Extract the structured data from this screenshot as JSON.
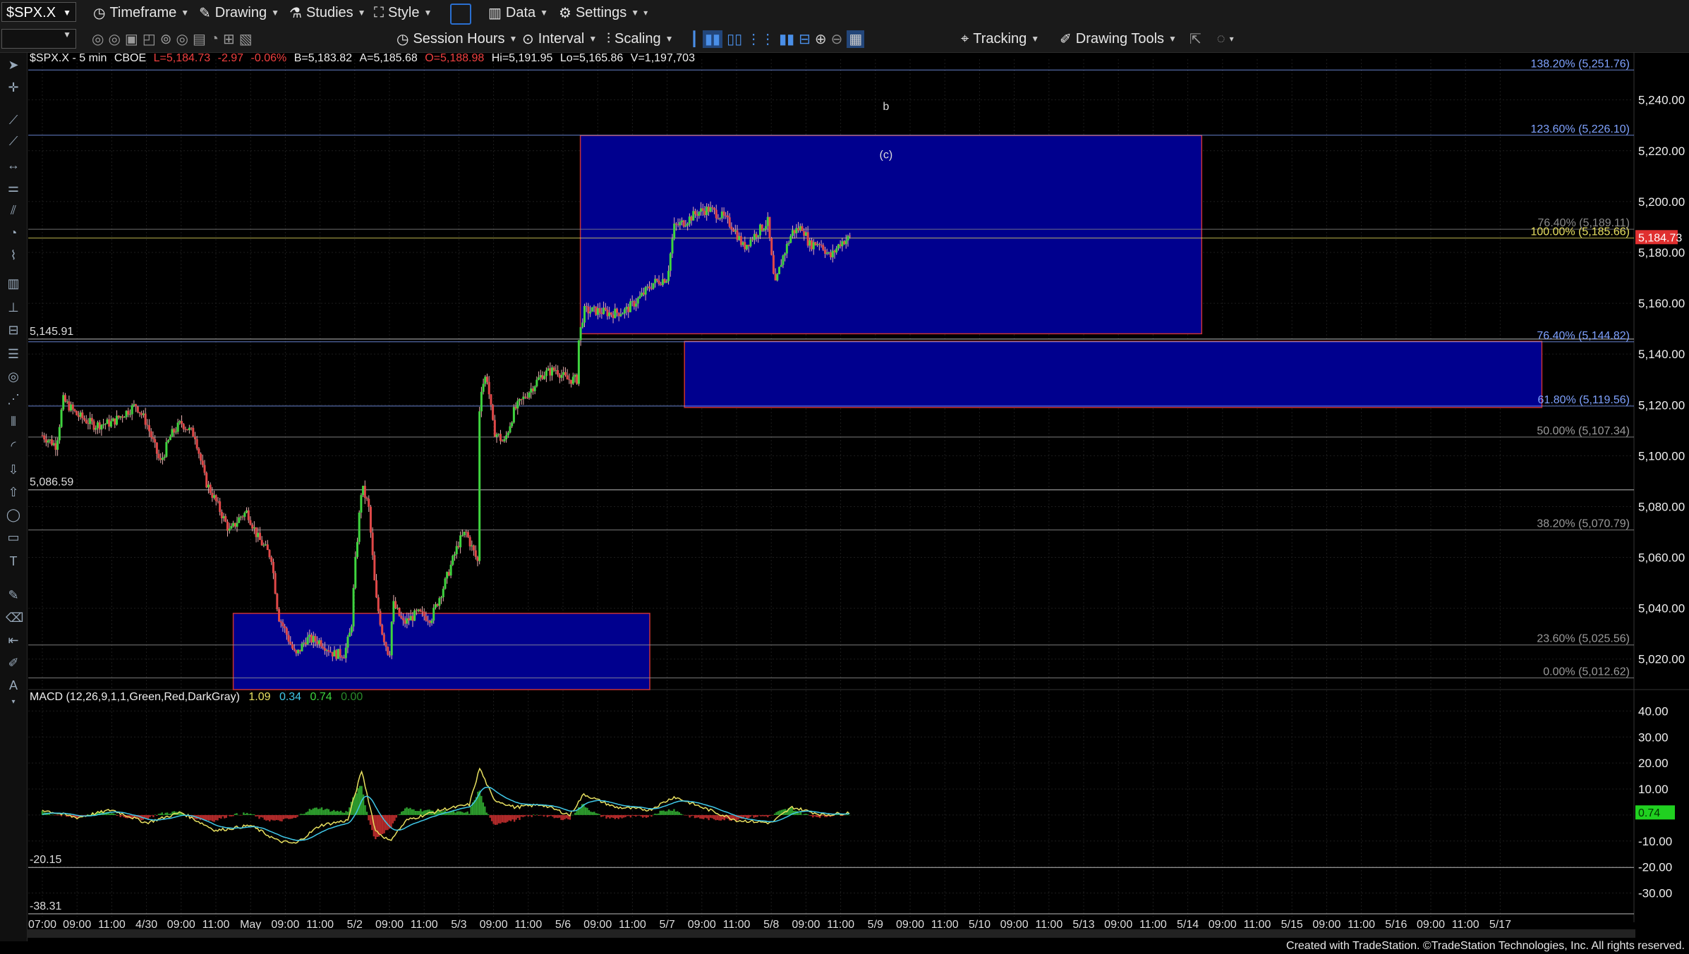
{
  "toolbar": {
    "symbol": "$SPX.X",
    "timeframe": "Timeframe",
    "drawing": "Drawing",
    "studies": "Studies",
    "style": "Style",
    "data": "Data",
    "settings": "Settings",
    "session_hours": "Session Hours",
    "interval": "Interval",
    "scaling": "Scaling",
    "tracking": "Tracking",
    "drawing_tools": "Drawing Tools"
  },
  "info_bar": {
    "symbol": "$SPX.X - 5 min",
    "exchange": "CBOE",
    "last": "L=5,184.73",
    "change": "-2.97",
    "change_pct": "-0.06%",
    "bid": "B=5,183.82",
    "ask": "A=5,185.68",
    "open": "O=5,188.98",
    "high": "Hi=5,191.95",
    "low": "Lo=5,165.86",
    "volume": "V=1,197,703"
  },
  "colors": {
    "up": "#3fd43f",
    "down": "#e04848",
    "box_fill": "#00008e",
    "box_border": "#c83232",
    "fib": "#9a9a9a",
    "price_tag": "#e03030",
    "macd_tag": "#20d020"
  },
  "chart_data": [
    {
      "type": "line",
      "subtype": "candlestick",
      "ylim": [
        5008,
        5256
      ],
      "y_ticks": [
        "5,020.00",
        "5,040.00",
        "5,060.00",
        "5,080.00",
        "5,100.00",
        "5,120.00",
        "5,140.00",
        "5,160.00",
        "5,180.00",
        "5,200.00",
        "5,220.00",
        "5,240.00"
      ],
      "y_tick_values": [
        5020,
        5040,
        5060,
        5080,
        5100,
        5120,
        5140,
        5160,
        5180,
        5200,
        5220,
        5240
      ],
      "x_ticks": [
        "07:00",
        "09:00",
        "11:00",
        "4/30",
        "09:00",
        "11:00",
        "May",
        "09:00",
        "11:00",
        "5/2",
        "09:00",
        "11:00",
        "5/3",
        "09:00",
        "11:00",
        "5/6",
        "09:00",
        "11:00",
        "5/7",
        "09:00",
        "11:00",
        "5/8",
        "09:00",
        "11:00",
        "5/9",
        "09:00",
        "11:00",
        "5/10",
        "09:00",
        "11:00",
        "5/13",
        "09:00",
        "11:00",
        "5/14",
        "09:00",
        "11:00",
        "5/15",
        "09:00",
        "11:00",
        "5/16",
        "09:00",
        "11:00",
        "5/17"
      ],
      "price_path": [
        {
          "t": 0,
          "v": 5108
        },
        {
          "t": 0.4,
          "v": 5104
        },
        {
          "t": 0.6,
          "v": 5122
        },
        {
          "t": 1.0,
          "v": 5116
        },
        {
          "t": 1.5,
          "v": 5112
        },
        {
          "t": 2.0,
          "v": 5113
        },
        {
          "t": 2.7,
          "v": 5120
        },
        {
          "t": 3.0,
          "v": 5113
        },
        {
          "t": 3.4,
          "v": 5097
        },
        {
          "t": 3.7,
          "v": 5108
        },
        {
          "t": 4.0,
          "v": 5113
        },
        {
          "t": 4.4,
          "v": 5108
        },
        {
          "t": 4.7,
          "v": 5090
        },
        {
          "t": 5.0,
          "v": 5082
        },
        {
          "t": 5.4,
          "v": 5070
        },
        {
          "t": 5.7,
          "v": 5076
        },
        {
          "t": 5.9,
          "v": 5078
        },
        {
          "t": 6.2,
          "v": 5068
        },
        {
          "t": 6.6,
          "v": 5060
        },
        {
          "t": 6.8,
          "v": 5037
        },
        {
          "t": 7.0,
          "v": 5031
        },
        {
          "t": 7.3,
          "v": 5021
        },
        {
          "t": 7.6,
          "v": 5028
        },
        {
          "t": 8.0,
          "v": 5027
        },
        {
          "t": 8.4,
          "v": 5022
        },
        {
          "t": 8.7,
          "v": 5022
        },
        {
          "t": 8.9,
          "v": 5032
        },
        {
          "t": 9.0,
          "v": 5055
        },
        {
          "t": 9.2,
          "v": 5088
        },
        {
          "t": 9.4,
          "v": 5080
        },
        {
          "t": 9.6,
          "v": 5045
        },
        {
          "t": 9.8,
          "v": 5030
        },
        {
          "t": 10.0,
          "v": 5021
        },
        {
          "t": 10.1,
          "v": 5042
        },
        {
          "t": 10.4,
          "v": 5034
        },
        {
          "t": 10.8,
          "v": 5038
        },
        {
          "t": 11.2,
          "v": 5036
        },
        {
          "t": 11.6,
          "v": 5050
        },
        {
          "t": 12.0,
          "v": 5066
        },
        {
          "t": 12.2,
          "v": 5070
        },
        {
          "t": 12.4,
          "v": 5063
        },
        {
          "t": 12.55,
          "v": 5058
        },
        {
          "t": 12.6,
          "v": 5125
        },
        {
          "t": 12.8,
          "v": 5132
        },
        {
          "t": 13.0,
          "v": 5110
        },
        {
          "t": 13.3,
          "v": 5105
        },
        {
          "t": 13.6,
          "v": 5118
        },
        {
          "t": 14.0,
          "v": 5125
        },
        {
          "t": 14.4,
          "v": 5132
        },
        {
          "t": 14.8,
          "v": 5134
        },
        {
          "t": 15.1,
          "v": 5130
        },
        {
          "t": 15.4,
          "v": 5130
        },
        {
          "t": 15.45,
          "v": 5145
        },
        {
          "t": 15.6,
          "v": 5157
        },
        {
          "t": 16.0,
          "v": 5157
        },
        {
          "t": 16.4,
          "v": 5156
        },
        {
          "t": 16.8,
          "v": 5157
        },
        {
          "t": 17.2,
          "v": 5162
        },
        {
          "t": 17.6,
          "v": 5168
        },
        {
          "t": 18.0,
          "v": 5170
        },
        {
          "t": 18.2,
          "v": 5190
        },
        {
          "t": 18.5,
          "v": 5192
        },
        {
          "t": 18.9,
          "v": 5196
        },
        {
          "t": 19.2,
          "v": 5197
        },
        {
          "t": 19.6,
          "v": 5194
        },
        {
          "t": 19.9,
          "v": 5190
        },
        {
          "t": 20.2,
          "v": 5182
        },
        {
          "t": 20.6,
          "v": 5188
        },
        {
          "t": 20.9,
          "v": 5192
        },
        {
          "t": 21.1,
          "v": 5166
        },
        {
          "t": 21.3,
          "v": 5177
        },
        {
          "t": 21.6,
          "v": 5188
        },
        {
          "t": 21.9,
          "v": 5190
        },
        {
          "t": 22.1,
          "v": 5183
        },
        {
          "t": 22.4,
          "v": 5184
        },
        {
          "t": 22.7,
          "v": 5178
        },
        {
          "t": 23.0,
          "v": 5184
        },
        {
          "t": 23.3,
          "v": 5186
        }
      ],
      "boxes": [
        {
          "t_start": 5.5,
          "t_end": 17.5,
          "top": 5038,
          "bottom": 5008
        },
        {
          "t_start": 15.5,
          "t_end": 33.4,
          "top": 5226,
          "bottom": 5148
        },
        {
          "t_start": 18.5,
          "t_end": 43.2,
          "top": 5145,
          "bottom": 5119
        }
      ],
      "fib_levels": [
        {
          "label": "138.20% (5,251.76)",
          "value": 5251.76,
          "color": "#7fa2ff"
        },
        {
          "label": "123.60% (5,226.10)",
          "value": 5226.1,
          "color": "#7fa2ff"
        },
        {
          "label": "100.00% (5,185.66)",
          "value": 5185.66,
          "color": "#e8e060"
        },
        {
          "label": "76.40% (5,189.11)",
          "value": 5189.11,
          "color": "#8a8a8a"
        },
        {
          "label": "76.40% (5,144.82)",
          "value": 5144.82,
          "color": "#7fa2ff"
        },
        {
          "label": "61.80% (5,119.56)",
          "value": 5119.56,
          "color": "#7fa2ff"
        },
        {
          "label": "50.00% (5,107.34)",
          "value": 5107.34,
          "color": "#9a9a9a"
        },
        {
          "label": "38.20% (5,070.79)",
          "value": 5070.79,
          "color": "#9a9a9a"
        },
        {
          "label": "23.60% (5,025.56)",
          "value": 5025.56,
          "color": "#9a9a9a"
        },
        {
          "label": "0.00% (5,012.62)",
          "value": 5012.62,
          "color": "#9a9a9a"
        }
      ],
      "h_levels": [
        {
          "label": "5,145.91",
          "value": 5145.91
        },
        {
          "label": "5,086.59",
          "value": 5086.59
        }
      ],
      "annotations": [
        {
          "text": "b",
          "t": 23.9,
          "v": 5236
        },
        {
          "text": "(c)",
          "t": 23.9,
          "v": 5217
        }
      ],
      "last_price_tag": "5,184.73"
    },
    {
      "type": "line",
      "title": "MACD (12,26,9,1,1,Green,Red,DarkGray)",
      "values_text": [
        "1.09",
        "0.34",
        "0.74",
        "0.00"
      ],
      "ylim": [
        -38,
        45
      ],
      "y_ticks": [
        "40.00",
        "30.00",
        "20.00",
        "10.00",
        "0.00",
        "-10.00",
        "-20.00",
        "-30.00"
      ],
      "y_tick_values": [
        40,
        30,
        20,
        10,
        0,
        -10,
        -20,
        -30
      ],
      "h_levels": [
        {
          "label": "-20.15",
          "value": -20.15
        },
        {
          "label": "-38.31",
          "value": -38.31
        }
      ],
      "last_tag": "0.74",
      "macd_path": [
        {
          "t": 0,
          "v": 2
        },
        {
          "t": 1,
          "v": -1
        },
        {
          "t": 2,
          "v": 2
        },
        {
          "t": 3,
          "v": -3
        },
        {
          "t": 4,
          "v": 1
        },
        {
          "t": 5,
          "v": -6
        },
        {
          "t": 6,
          "v": -4
        },
        {
          "t": 6.8,
          "v": -10
        },
        {
          "t": 7.3,
          "v": -11
        },
        {
          "t": 8,
          "v": -4
        },
        {
          "t": 8.8,
          "v": -2
        },
        {
          "t": 9.2,
          "v": 17
        },
        {
          "t": 9.6,
          "v": -6
        },
        {
          "t": 10.0,
          "v": -10
        },
        {
          "t": 10.5,
          "v": -2
        },
        {
          "t": 11.5,
          "v": 2
        },
        {
          "t": 12.3,
          "v": 4
        },
        {
          "t": 12.6,
          "v": 18
        },
        {
          "t": 13.0,
          "v": 6
        },
        {
          "t": 13.6,
          "v": 3
        },
        {
          "t": 14.4,
          "v": 4
        },
        {
          "t": 15.2,
          "v": 0
        },
        {
          "t": 15.6,
          "v": 8
        },
        {
          "t": 16.5,
          "v": 3
        },
        {
          "t": 17.5,
          "v": 2
        },
        {
          "t": 18.2,
          "v": 7
        },
        {
          "t": 19.0,
          "v": 3
        },
        {
          "t": 20.0,
          "v": -2
        },
        {
          "t": 21.0,
          "v": -3
        },
        {
          "t": 21.6,
          "v": 3
        },
        {
          "t": 22.5,
          "v": 0
        },
        {
          "t": 23.3,
          "v": 1
        }
      ]
    }
  ],
  "footer": "Created with TradeStation. ©TradeStation Technologies, Inc. All rights reserved."
}
